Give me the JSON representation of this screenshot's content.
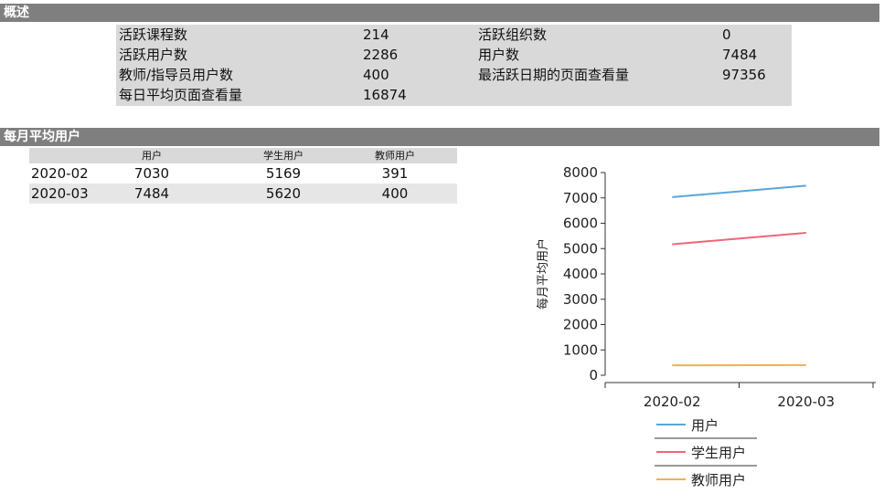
{
  "overview": {
    "title": "概述",
    "rows": [
      [
        {
          "label": "活跃课程数",
          "value": "214"
        },
        {
          "label": "活跃组织数",
          "value": "0"
        }
      ],
      [
        {
          "label": "活跃用户数",
          "value": "2286"
        },
        {
          "label": "用户数",
          "value": "7484"
        }
      ],
      [
        {
          "label": "教师/指导员用户数",
          "value": "400"
        },
        {
          "label": "最活跃日期的页面查看量",
          "value": "97356"
        }
      ],
      [
        {
          "label": "每日平均页面查看量",
          "value": "16874"
        }
      ]
    ]
  },
  "mau": {
    "title": "每月平均用户",
    "headers": [
      "",
      "用户",
      "学生用户",
      "教师用户"
    ],
    "rows": [
      [
        "2020-02",
        "7030",
        "5169",
        "391"
      ],
      [
        "2020-03",
        "7484",
        "5620",
        "400"
      ]
    ]
  },
  "chart_data": {
    "type": "line",
    "categories": [
      "2020-02",
      "2020-03"
    ],
    "series": [
      {
        "name": "用户",
        "values": [
          7030,
          7484
        ],
        "color": "#5aa6d8"
      },
      {
        "name": "学生用户",
        "values": [
          5169,
          5620
        ],
        "color": "#ee6677"
      },
      {
        "name": "教师用户",
        "values": [
          391,
          400
        ],
        "color": "#f0b050"
      }
    ],
    "ylabel": "每月平均用户",
    "ylim": [
      0,
      8000
    ],
    "yticks": [
      0,
      1000,
      2000,
      3000,
      4000,
      5000,
      6000,
      7000,
      8000
    ],
    "grid": false,
    "legend": "bottom"
  }
}
